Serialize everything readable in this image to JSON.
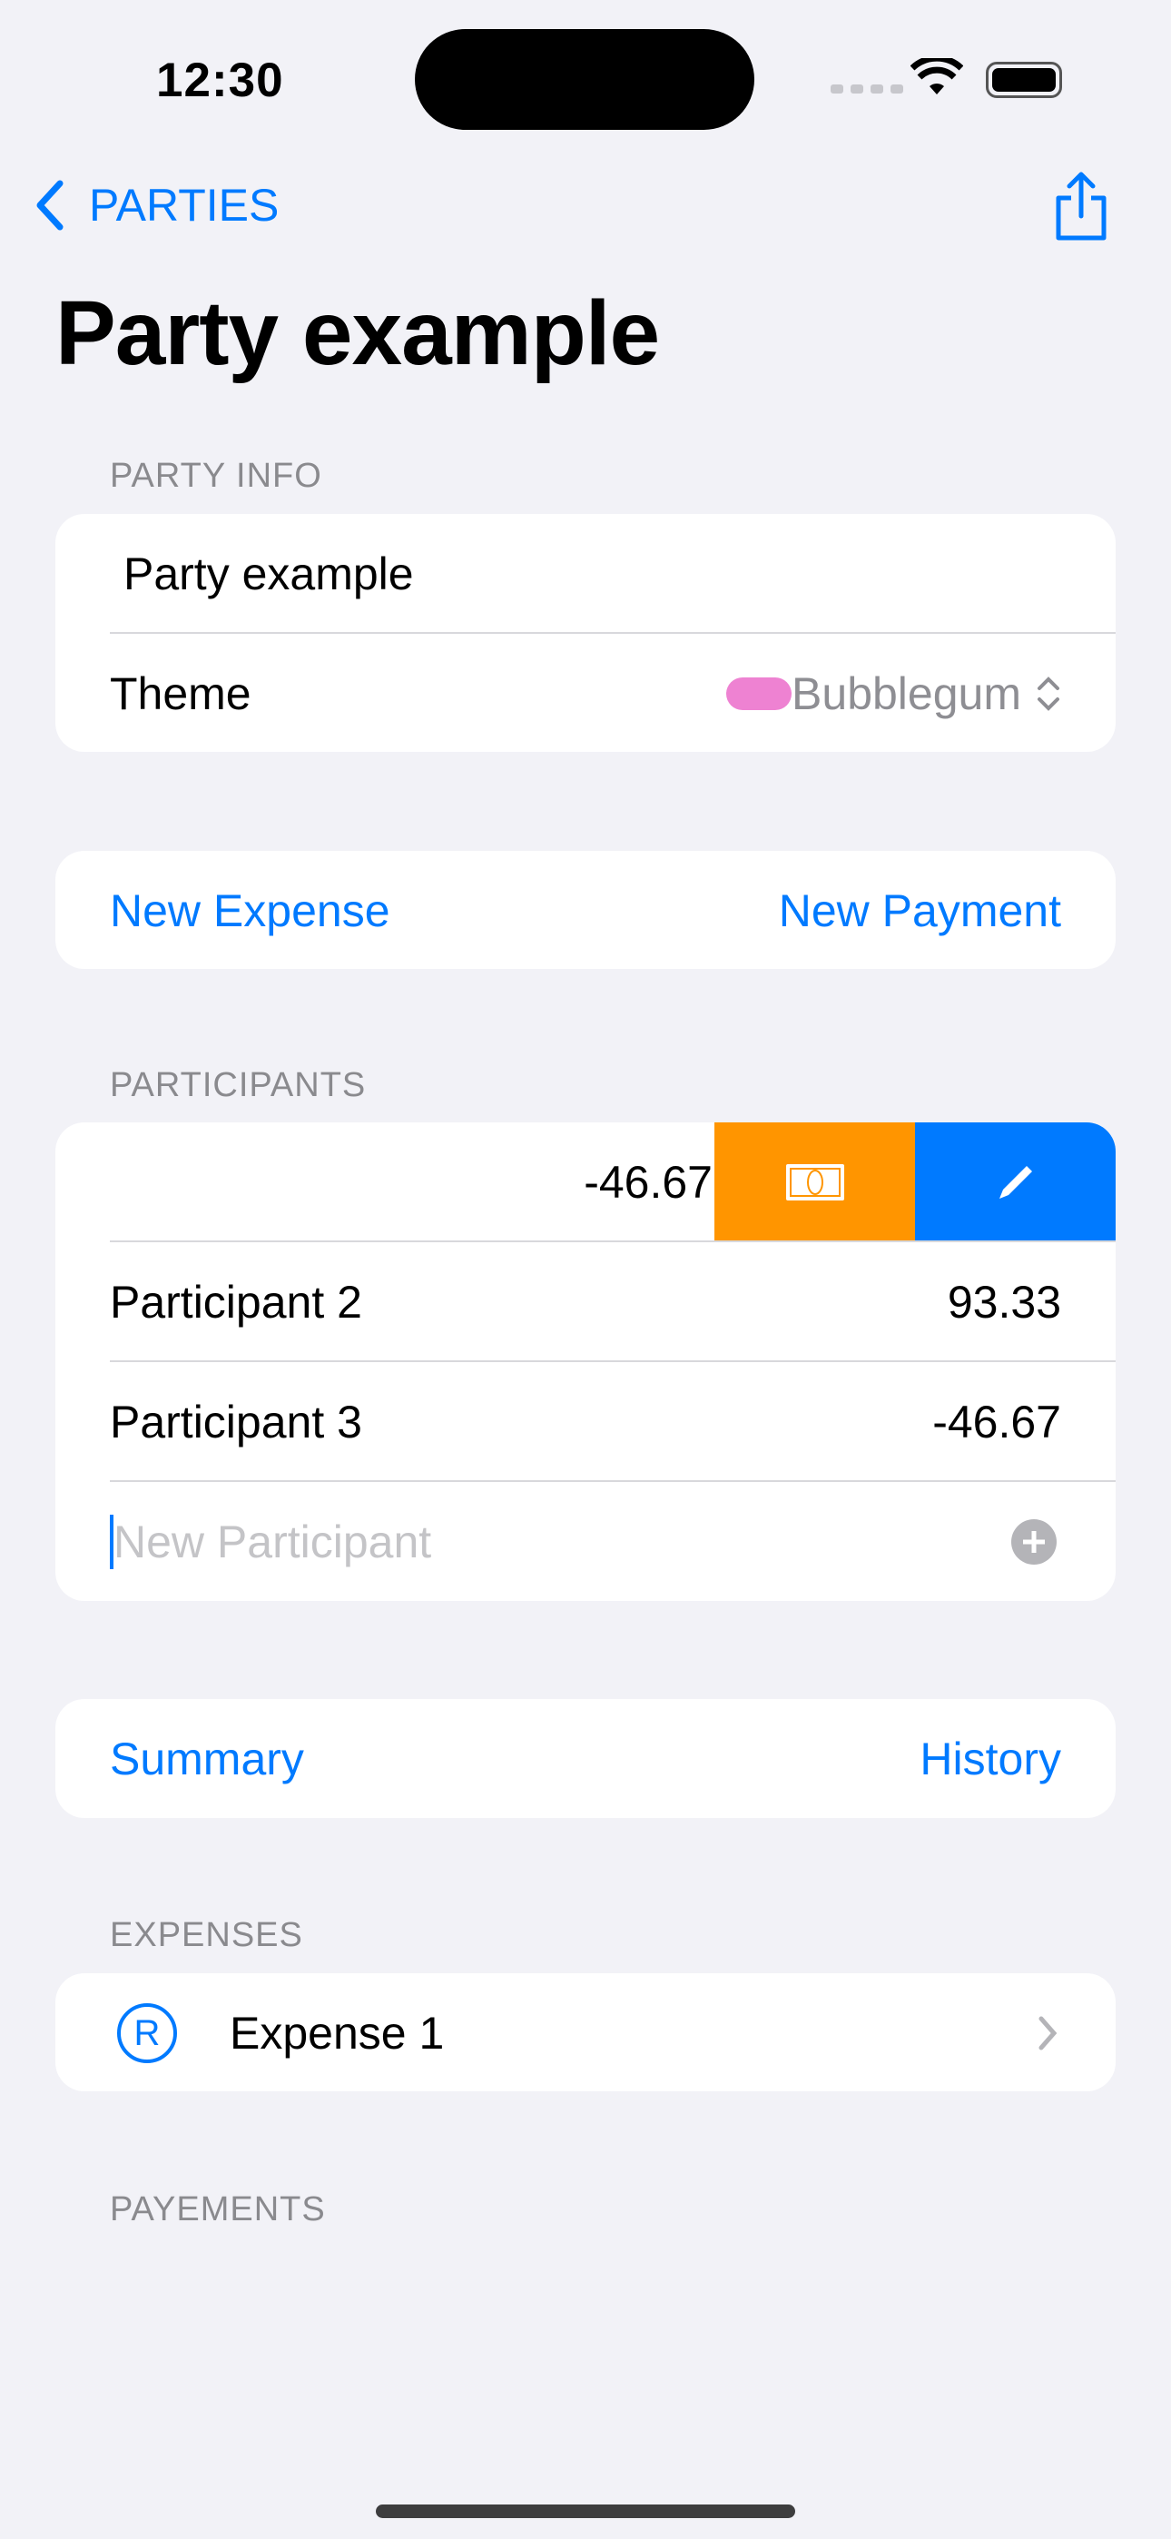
{
  "status": {
    "time": "12:30"
  },
  "nav": {
    "back_label": "PARTIES",
    "title": "Party example"
  },
  "party_info": {
    "header": "PARTY INFO",
    "name_value": "Party example",
    "theme_label": "Theme",
    "theme_value": "Bubblegum",
    "theme_color": "#ee82d2"
  },
  "actions1": {
    "new_expense": "New Expense",
    "new_payment": "New Payment"
  },
  "participants": {
    "header": "PARTICIPANTS",
    "rows": [
      {
        "name": "",
        "balance": "-46.67"
      },
      {
        "name": "Participant 2",
        "balance": "93.33"
      },
      {
        "name": "Participant 3",
        "balance": "-46.67"
      }
    ],
    "new_placeholder": "New Participant",
    "swipe_pay_color": "#ff9500",
    "swipe_edit_color": "#007aff"
  },
  "actions2": {
    "summary": "Summary",
    "history": "History"
  },
  "expenses": {
    "header": "EXPENSES",
    "items": [
      {
        "icon_letter": "R",
        "title": "Expense 1"
      }
    ]
  },
  "payments": {
    "header": "PAYEMENTS"
  }
}
